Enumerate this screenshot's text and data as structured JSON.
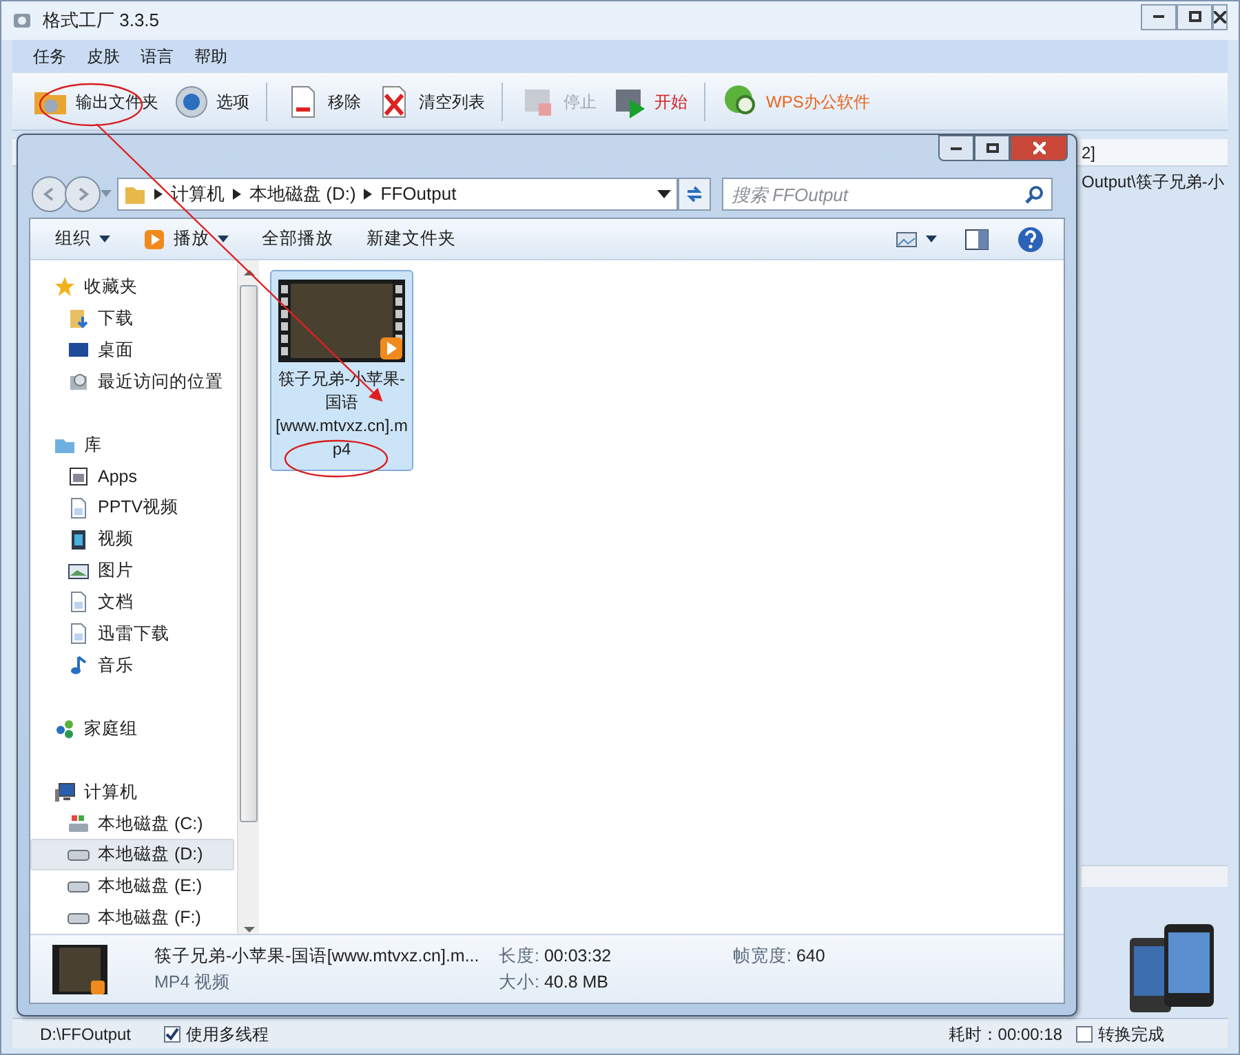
{
  "app": {
    "title": "格式工厂 3.3.5",
    "menu": [
      "任务",
      "皮肤",
      "语言",
      "帮助"
    ],
    "toolbar": [
      {
        "label": "输出文件夹",
        "kind": "folder",
        "disabled": false
      },
      {
        "label": "选项",
        "kind": "options",
        "disabled": false
      },
      {
        "label": "移除",
        "kind": "remove",
        "disabled": false
      },
      {
        "label": "清空列表",
        "kind": "clear",
        "disabled": false
      },
      {
        "label": "停止",
        "kind": "stop",
        "disabled": true
      },
      {
        "label": "开始",
        "kind": "start",
        "disabled": false
      },
      {
        "label": "WPS办公软件",
        "kind": "wps",
        "disabled": false
      }
    ],
    "list_header": "2]",
    "list_row": "Output\\筷子兄弟-小",
    "status_bar": {
      "path": "D:\\FFOutput",
      "multithread": {
        "label": "使用多线程",
        "checked": true
      },
      "elapsed": "耗时：00:00:18",
      "done": {
        "label": "转换完成",
        "checked": false
      }
    }
  },
  "explorer": {
    "breadcrumb": [
      "计算机",
      "本地磁盘 (D:)",
      "FFOutput"
    ],
    "search": {
      "placeholder": "搜索 FFOutput"
    },
    "commands": [
      {
        "label": "组织",
        "dropdown": true,
        "kind": "plain"
      },
      {
        "label": "播放",
        "dropdown": true,
        "kind": "play"
      },
      {
        "label": "全部播放",
        "dropdown": false,
        "kind": "plain"
      },
      {
        "label": "新建文件夹",
        "dropdown": false,
        "kind": "plain"
      }
    ],
    "nav": [
      {
        "label": "收藏夹",
        "kind": "star",
        "selected": false,
        "children": [
          {
            "label": "下载",
            "kind": "download",
            "selected": false
          },
          {
            "label": "桌面",
            "kind": "desktop",
            "selected": false
          },
          {
            "label": "最近访问的位置",
            "kind": "recent",
            "selected": false
          }
        ]
      },
      {
        "label": "库",
        "kind": "library",
        "selected": false,
        "children": [
          {
            "label": "Apps",
            "kind": "app",
            "selected": false
          },
          {
            "label": "PPTV视频",
            "kind": "doc",
            "selected": false
          },
          {
            "label": "视频",
            "kind": "video",
            "selected": false
          },
          {
            "label": "图片",
            "kind": "picture",
            "selected": false
          },
          {
            "label": "文档",
            "kind": "doc",
            "selected": false
          },
          {
            "label": "迅雷下载",
            "kind": "doc",
            "selected": false
          },
          {
            "label": "音乐",
            "kind": "music",
            "selected": false
          }
        ]
      },
      {
        "label": "家庭组",
        "kind": "homegroup",
        "selected": false
      },
      {
        "label": "计算机",
        "kind": "computer",
        "selected": false,
        "children": [
          {
            "label": "本地磁盘 (C:)",
            "kind": "sysdrive",
            "selected": false
          },
          {
            "label": "本地磁盘 (D:)",
            "kind": "drive",
            "selected": true
          },
          {
            "label": "本地磁盘 (E:)",
            "kind": "drive",
            "selected": false
          },
          {
            "label": "本地磁盘 (F:)",
            "kind": "drive",
            "selected": false
          }
        ]
      }
    ],
    "files": [
      {
        "name": "筷子兄弟-小苹果-国语[www.mtvxz.cn].mp4",
        "selected": true
      }
    ],
    "details": {
      "name": "筷子兄弟-小苹果-国语[www.mtvxz.cn].m...",
      "type": "MP4 视频",
      "fields": [
        {
          "label": "长度:",
          "value": "00:03:32"
        },
        {
          "label": "帧宽度:",
          "value": "640"
        },
        {
          "label": "大小:",
          "value": "40.8 MB"
        }
      ]
    }
  }
}
